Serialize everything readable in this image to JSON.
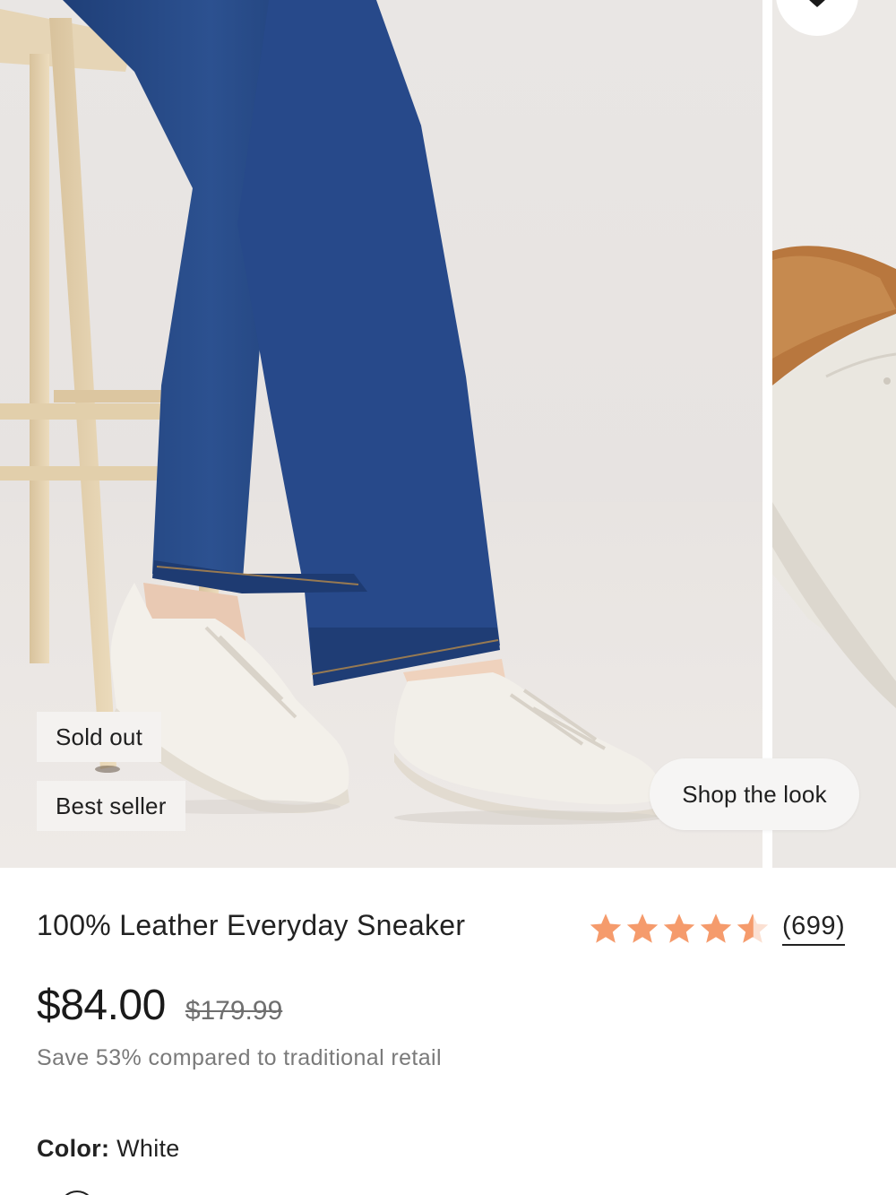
{
  "gallery": {
    "main_image_alt": "",
    "badges": [
      "Sold out",
      "Best seller"
    ],
    "shop_the_look_label": "Shop the look",
    "favorite_icon": "heart-icon"
  },
  "product": {
    "title": "100% Leather Everyday Sneaker",
    "rating": {
      "value": 4.5,
      "max": 5,
      "reviews_label": "(699)",
      "star_color": "#f59b6c"
    },
    "price": "$84.00",
    "original_price": "$179.99",
    "savings_text": "Save 53% compared to traditional retail",
    "color_label": "Color:",
    "color_value": "White"
  }
}
